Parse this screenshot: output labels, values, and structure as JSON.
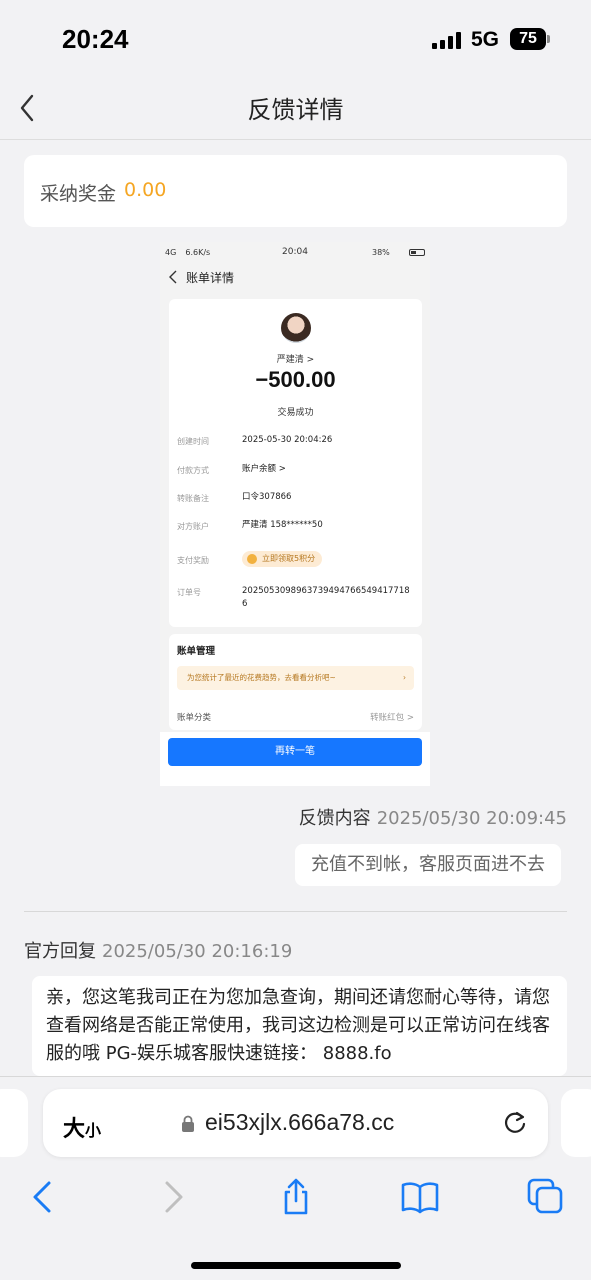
{
  "status_bar": {
    "time": "20:24",
    "network": "5G",
    "battery": "75"
  },
  "nav": {
    "title": "反馈详情"
  },
  "reward": {
    "label": "采纳奖金",
    "value": "0.00"
  },
  "screenshot": {
    "status_left": "4G   6.6K/s",
    "status_time": "20:04",
    "status_battery": "38%",
    "title": "账单详情",
    "payee": "严建清 >",
    "amount": "−500.00",
    "status": "交易成功",
    "rows": [
      {
        "key": "创建时间",
        "value": "2025-05-30 20:04:26"
      },
      {
        "key": "付款方式",
        "value": "账户余额 >"
      },
      {
        "key": "转账备注",
        "value": "口令307866"
      },
      {
        "key": "对方账户",
        "value": "严建清 158******50"
      },
      {
        "key": "支付奖励",
        "value": "立即领取5积分"
      },
      {
        "key": "订单号",
        "value": "20250530989637394947665494177186"
      }
    ],
    "mgmt_title": "账单管理",
    "mgmt_banner": "为您统计了最近的花费趋势，去看看分析吧~",
    "mgmt_category_label": "账单分类",
    "mgmt_category_value": "转账红包 >",
    "button": "再转一笔"
  },
  "feedback": {
    "label": "反馈内容",
    "time": "2025/05/30 20:09:45",
    "content": "充值不到帐，客服页面进不去"
  },
  "reply": {
    "label": "官方回复",
    "time": "2025/05/30 20:16:19",
    "content": "亲，您这笔我司正在为您加急查询，期间还请您耐心等待，请您查看网络是否能正常使用，我司这边检测是可以正常访问在线客服的哦 PG-娱乐城客服快速链接： 8888.fo"
  },
  "browser": {
    "text_size": "大",
    "text_size_small": "小",
    "url": "ei53xjlx.666a78.cc"
  },
  "colors": {
    "reward": "#f5a623",
    "primary_button": "#1677ff",
    "background": "#f2f2f4"
  }
}
